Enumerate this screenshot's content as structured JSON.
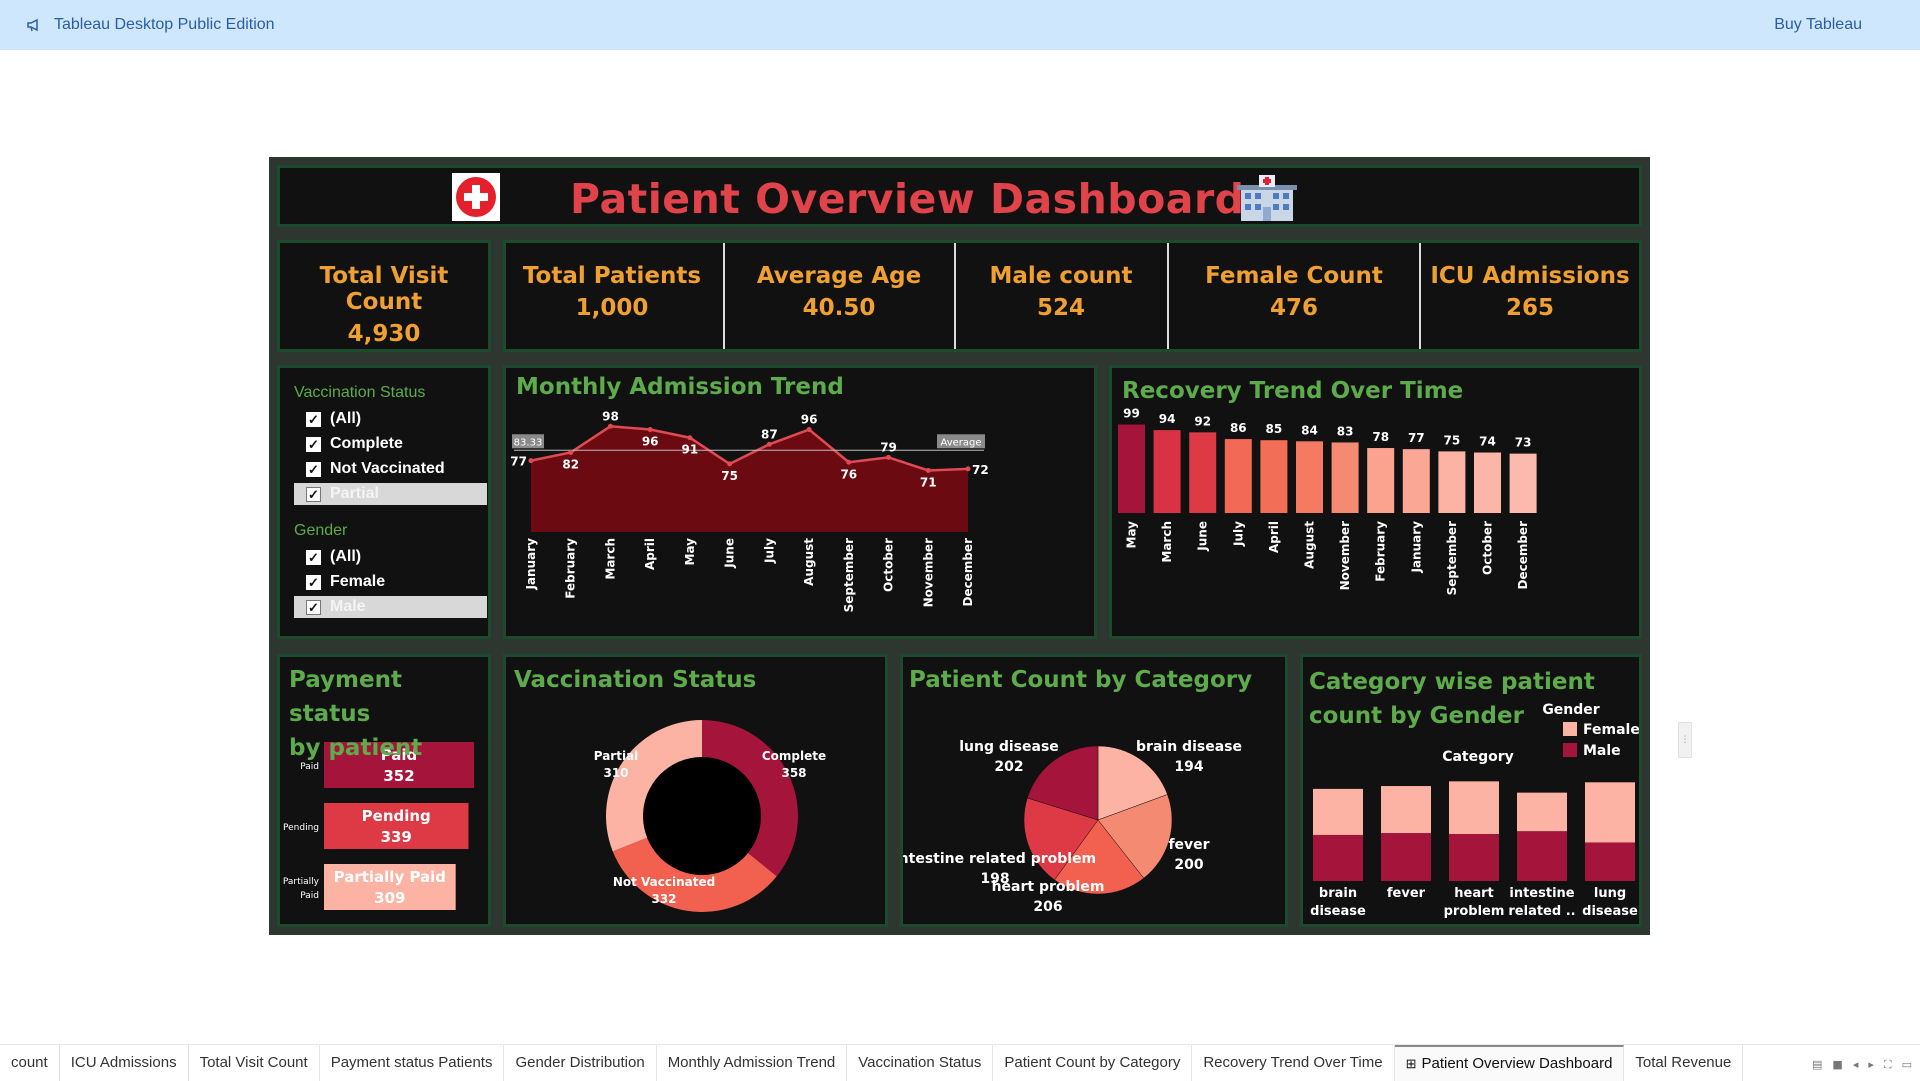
{
  "topbar": {
    "app_title": "Tableau Desktop Public Edition",
    "buy_label": "Buy Tableau",
    "app_icon": "megaphone-icon"
  },
  "dashboard": {
    "title": "Patient Overview Dashboard",
    "logo_icon": "red-cross-icon",
    "hospital_icon": "hospital-icon",
    "kpis": [
      {
        "label": "Total Visit Count",
        "value": "4,930"
      },
      {
        "label": "Total Patients",
        "value": "1,000"
      },
      {
        "label": "Average Age",
        "value": "40.50"
      },
      {
        "label": "Male count",
        "value": "524"
      },
      {
        "label": "Female Count",
        "value": "476"
      },
      {
        "label": "ICU Admissions",
        "value": "265"
      }
    ],
    "filters": {
      "vaccination": {
        "title": "Vaccination Status",
        "options": [
          {
            "label": "(All)",
            "checked": true,
            "selected": false
          },
          {
            "label": "Complete",
            "checked": true,
            "selected": false
          },
          {
            "label": "Not Vaccinated",
            "checked": true,
            "selected": false
          },
          {
            "label": "Partial",
            "checked": true,
            "selected": true
          }
        ]
      },
      "gender": {
        "title": "Gender",
        "options": [
          {
            "label": "(All)",
            "checked": true,
            "selected": false
          },
          {
            "label": "Female",
            "checked": true,
            "selected": false
          },
          {
            "label": "Male",
            "checked": true,
            "selected": true
          }
        ]
      }
    },
    "panels": {
      "monthly": "Monthly Admission Trend",
      "recovery": "Recovery Trend Over Time",
      "payment_title_1": "Payment status",
      "payment_title_2": "by patient",
      "vaccination": "Vaccination Status",
      "patient_category": "Patient Count by Category",
      "gender_title_1": "Category  wise patient",
      "gender_title_2": "count by Gender"
    }
  },
  "chart_data": [
    {
      "type": "area",
      "title": "Monthly Admission Trend",
      "categories": [
        "January",
        "February",
        "March",
        "April",
        "May",
        "June",
        "July",
        "August",
        "September",
        "October",
        "November",
        "December"
      ],
      "values": [
        77,
        82,
        98,
        96,
        91,
        75,
        87,
        96,
        76,
        79,
        71,
        72
      ],
      "reference_line": {
        "label": "Average",
        "value": 83.33,
        "value_label": "83.33"
      },
      "colors": {
        "fill": "#6b0a10",
        "line": "#e04a55"
      }
    },
    {
      "type": "bar",
      "title": "Recovery Trend Over Time",
      "categories": [
        "May",
        "March",
        "June",
        "July",
        "April",
        "August",
        "November",
        "February",
        "January",
        "September",
        "October",
        "December"
      ],
      "values": [
        99,
        94,
        92,
        86,
        85,
        84,
        83,
        78,
        77,
        75,
        74,
        73
      ],
      "colors": [
        "#a5143a",
        "#d93244",
        "#de3a45",
        "#f26a55",
        "#f36e57",
        "#f47a62",
        "#f58a72",
        "#fca390",
        "#fba796",
        "#fcb3a4",
        "#fcb6a8",
        "#fcbaae"
      ]
    },
    {
      "type": "bar",
      "orientation": "horizontal",
      "title": "Payment status by patient",
      "categories": [
        "Paid",
        "Pending",
        "Partially Paid"
      ],
      "axis_labels": [
        "Paid",
        "Pending",
        "Partially\nPaid"
      ],
      "values": [
        352,
        339,
        309
      ],
      "colors": [
        "#a5143a",
        "#de3a45",
        "#fcb3a4"
      ]
    },
    {
      "type": "pie",
      "variant": "donut",
      "title": "Vaccination Status",
      "categories": [
        "Complete",
        "Not Vaccinated",
        "Partial"
      ],
      "values": [
        358,
        332,
        310
      ],
      "colors": [
        "#a5143a",
        "#f2604f",
        "#fcb3a4"
      ]
    },
    {
      "type": "pie",
      "title": "Patient Count by Category",
      "categories": [
        "brain disease",
        "fever",
        "heart problem",
        "intestine related problem",
        "lung disease"
      ],
      "values": [
        194,
        200,
        206,
        198,
        202
      ],
      "colors": [
        "#fcb3a4",
        "#f58a72",
        "#f2604f",
        "#de3a45",
        "#a5143a"
      ]
    },
    {
      "type": "bar",
      "stacked": true,
      "title": "Category  wise patient count by Gender",
      "categories": [
        "brain disease",
        "fever",
        "heart problem",
        "intestine related ..",
        "lung disease"
      ],
      "axis_title": "Category",
      "legend_title": "Gender",
      "series": [
        {
          "name": "Male",
          "values": [
            49,
            51,
            50,
            53,
            41
          ],
          "color": "#a5143a"
        },
        {
          "name": "Female",
          "values": [
            49,
            50,
            56,
            41,
            64
          ],
          "color": "#fcb3a4"
        }
      ]
    }
  ],
  "tabs": [
    {
      "label": "count",
      "active": false
    },
    {
      "label": "ICU Admissions",
      "active": false
    },
    {
      "label": "Total Visit Count",
      "active": false
    },
    {
      "label": "Payment status Patients",
      "active": false
    },
    {
      "label": "Gender Distribution",
      "active": false
    },
    {
      "label": "Monthly Admission Trend",
      "active": false
    },
    {
      "label": "Vaccination Status",
      "active": false
    },
    {
      "label": "Patient Count by Category",
      "active": false
    },
    {
      "label": "Recovery Trend Over Time",
      "active": false
    },
    {
      "label": "Patient Overview Dashboard",
      "active": true
    },
    {
      "label": "Total Revenue",
      "active": false
    }
  ]
}
